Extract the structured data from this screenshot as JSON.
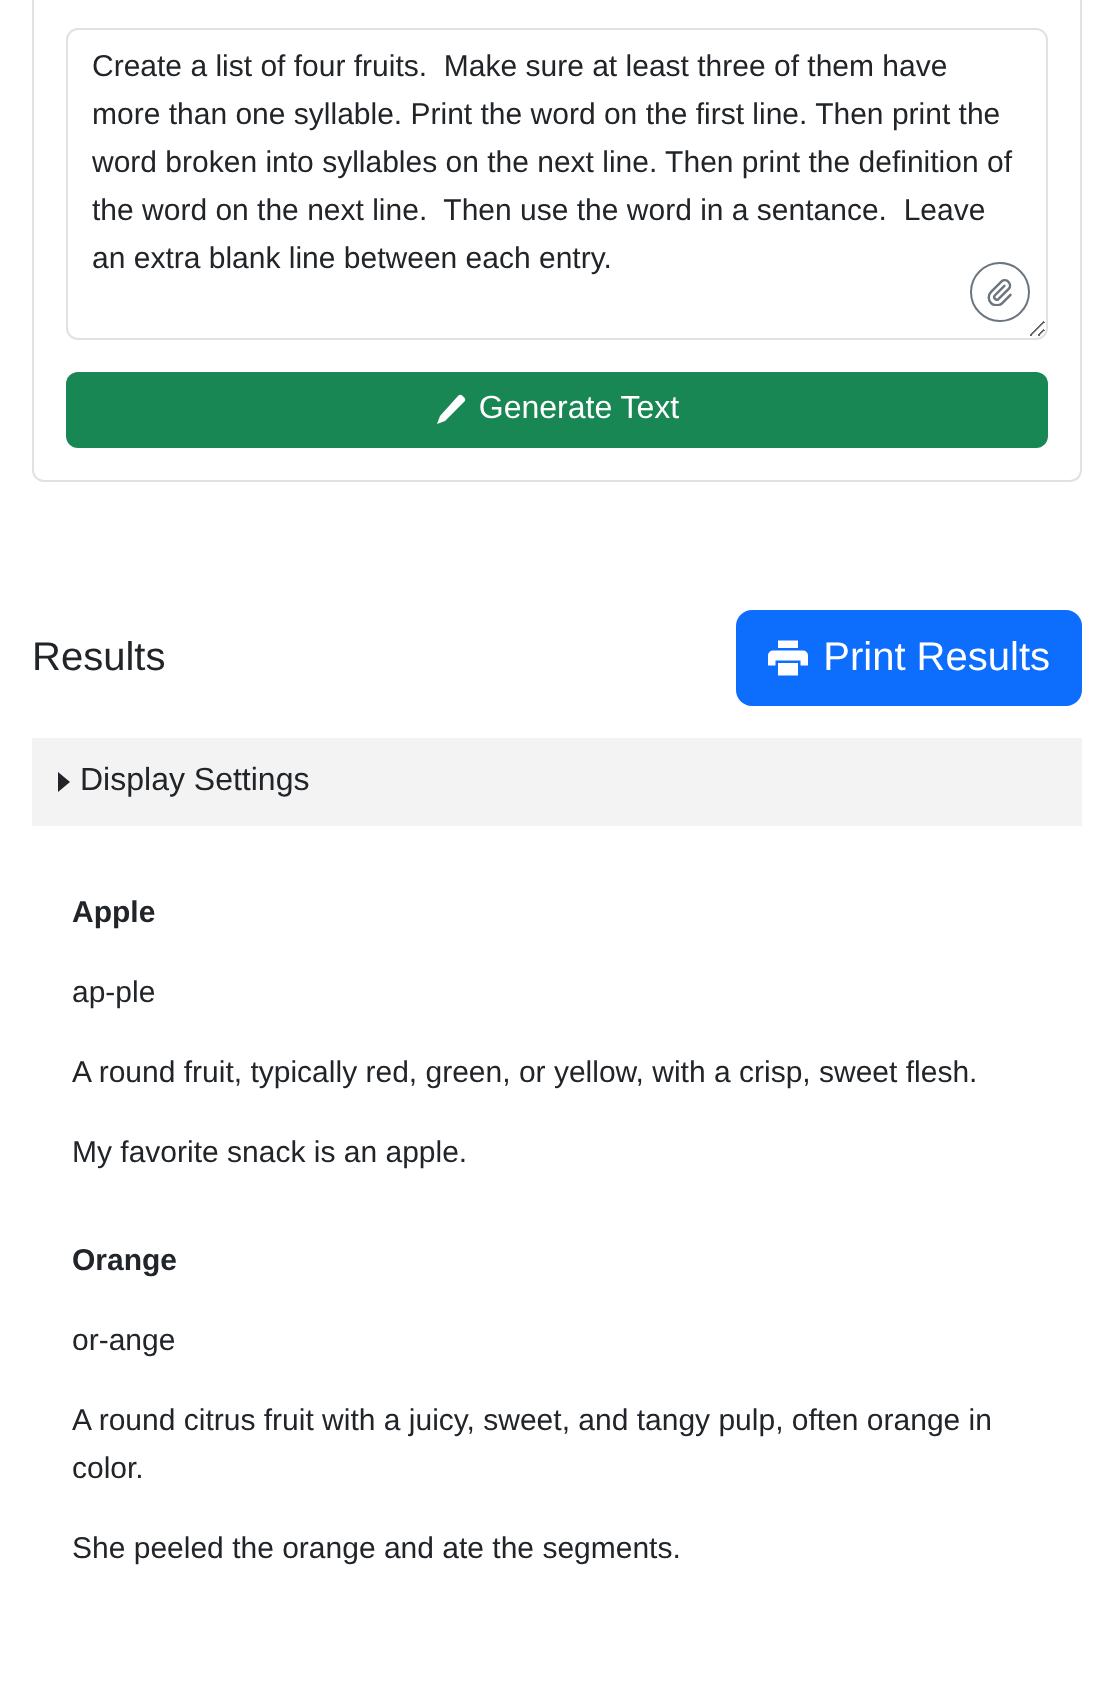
{
  "prompt": {
    "value": "Create a list of four fruits.  Make sure at least three of them have more than one syllable. Print the word on the first line. Then print the word broken into syllables on the next line. Then print the definition of the word on the next line.  Then use the word in a sentance.  Leave an extra blank line between each entry."
  },
  "generate_button": {
    "label": "Generate Text"
  },
  "results": {
    "title": "Results",
    "print_button": {
      "label": "Print Results"
    },
    "display_settings": {
      "label": "Display Settings",
      "expanded": false
    },
    "entries": [
      {
        "word": "Apple",
        "syllables": "ap-ple",
        "definition": "A round fruit, typically red, green, or yellow, with a crisp, sweet flesh.",
        "sentence": "My favorite snack is an apple."
      },
      {
        "word": "Orange",
        "syllables": "or-ange",
        "definition": "A round citrus fruit with a juicy, sweet, and tangy pulp, often orange in color.",
        "sentence": "She peeled the orange and ate the segments."
      }
    ]
  }
}
